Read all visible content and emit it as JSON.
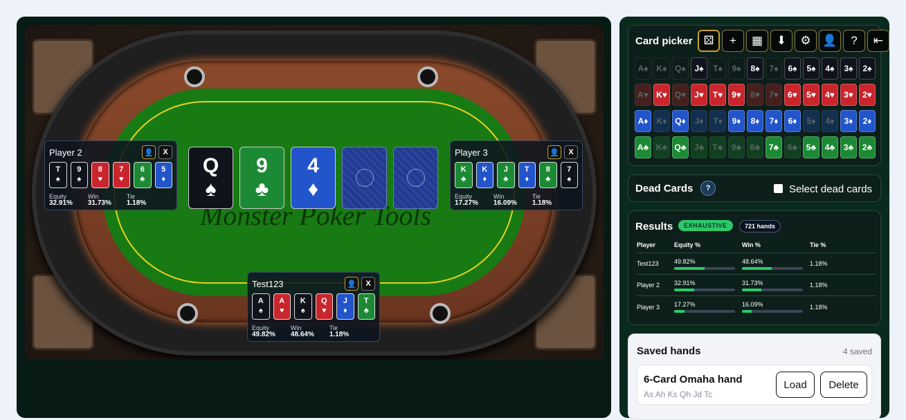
{
  "table": {
    "watermark": "Monster Poker Tools",
    "board": [
      {
        "rank": "Q",
        "suit": "♠",
        "color": "k"
      },
      {
        "rank": "9",
        "suit": "♣",
        "color": "g"
      },
      {
        "rank": "4",
        "suit": "♦",
        "color": "b"
      },
      {
        "rank": "",
        "suit": "",
        "color": "back"
      },
      {
        "rank": "",
        "suit": "",
        "color": "back"
      }
    ],
    "players": [
      {
        "name": "Player 2",
        "remove": "X",
        "cards": [
          [
            "T",
            "♠",
            "k"
          ],
          [
            "9",
            "♠",
            "k"
          ],
          [
            "8",
            "♥",
            "r_"
          ],
          [
            "7",
            "♥",
            "r_"
          ],
          [
            "6",
            "♣",
            "g"
          ],
          [
            "5",
            "♦",
            "b"
          ]
        ],
        "equity_label": "Equity",
        "equity": "32.91%",
        "win_label": "Win",
        "win": "31.73%",
        "tie_label": "Tie",
        "tie": "1.18%"
      },
      {
        "name": "Player 3",
        "remove": "X",
        "cards": [
          [
            "K",
            "♣",
            "g"
          ],
          [
            "K",
            "♦",
            "b"
          ],
          [
            "J",
            "♣",
            "g"
          ],
          [
            "T",
            "♦",
            "b"
          ],
          [
            "8",
            "♣",
            "g"
          ],
          [
            "7",
            "♠",
            "k"
          ]
        ],
        "equity_label": "Equity",
        "equity": "17.27%",
        "win_label": "Win",
        "win": "16.09%",
        "tie_label": "Tie",
        "tie": "1.18%"
      },
      {
        "name": "Test123",
        "remove": "X",
        "cards": [
          [
            "A",
            "♠",
            "k"
          ],
          [
            "A",
            "♥",
            "r_"
          ],
          [
            "K",
            "♠",
            "k"
          ],
          [
            "Q",
            "♥",
            "r_"
          ],
          [
            "J",
            "♦",
            "b"
          ],
          [
            "T",
            "♣",
            "g"
          ]
        ],
        "equity_label": "Equity",
        "equity": "49.82%",
        "win_label": "Win",
        "win": "48.64%",
        "tie_label": "Tie",
        "tie": "1.18%"
      }
    ]
  },
  "card_picker": {
    "title": "Card picker",
    "tools": [
      "random-icon",
      "plus-icon",
      "calculator-icon",
      "download-icon",
      "gear-icon",
      "user-icon",
      "help-icon",
      "logout-icon"
    ],
    "ranks": [
      "A",
      "K",
      "Q",
      "J",
      "T",
      "9",
      "8",
      "7",
      "6",
      "5",
      "4",
      "3",
      "2"
    ],
    "rows": [
      {
        "suit": "♠",
        "color": "k",
        "dim": [
          0,
          1,
          2,
          4,
          5,
          7
        ]
      },
      {
        "suit": "♥",
        "color": "r_",
        "dim": [
          0,
          2,
          6,
          7
        ]
      },
      {
        "suit": "♦",
        "color": "b",
        "dim": [
          1,
          3,
          4,
          9,
          10
        ]
      },
      {
        "suit": "♣",
        "color": "g",
        "dim": [
          1,
          3,
          4,
          5,
          6,
          8
        ]
      }
    ]
  },
  "dead_cards": {
    "title": "Dead Cards",
    "help": "?",
    "checkbox_label": "Select dead cards"
  },
  "results": {
    "title": "Results",
    "mode": "EXHAUSTIVE",
    "hands": "721 hands",
    "headers": [
      "Player",
      "Equity %",
      "Win %",
      "Tie %"
    ],
    "rows": [
      {
        "player": "Test123",
        "equity": "49.82%",
        "equity_val": 49.82,
        "win": "48.64%",
        "win_val": 48.64,
        "tie": "1.18%"
      },
      {
        "player": "Player 2",
        "equity": "32.91%",
        "equity_val": 32.91,
        "win": "31.73%",
        "win_val": 31.73,
        "tie": "1.18%"
      },
      {
        "player": "Player 3",
        "equity": "17.27%",
        "equity_val": 17.27,
        "win": "16.09%",
        "win_val": 16.09,
        "tie": "1.18%"
      }
    ]
  },
  "saved": {
    "title": "Saved hands",
    "count": "4 saved",
    "item": {
      "name": "6-Card Omaha hand",
      "cards": "As Ah Ks Qh Jd Tc",
      "load": "Load",
      "delete": "Delete"
    }
  }
}
